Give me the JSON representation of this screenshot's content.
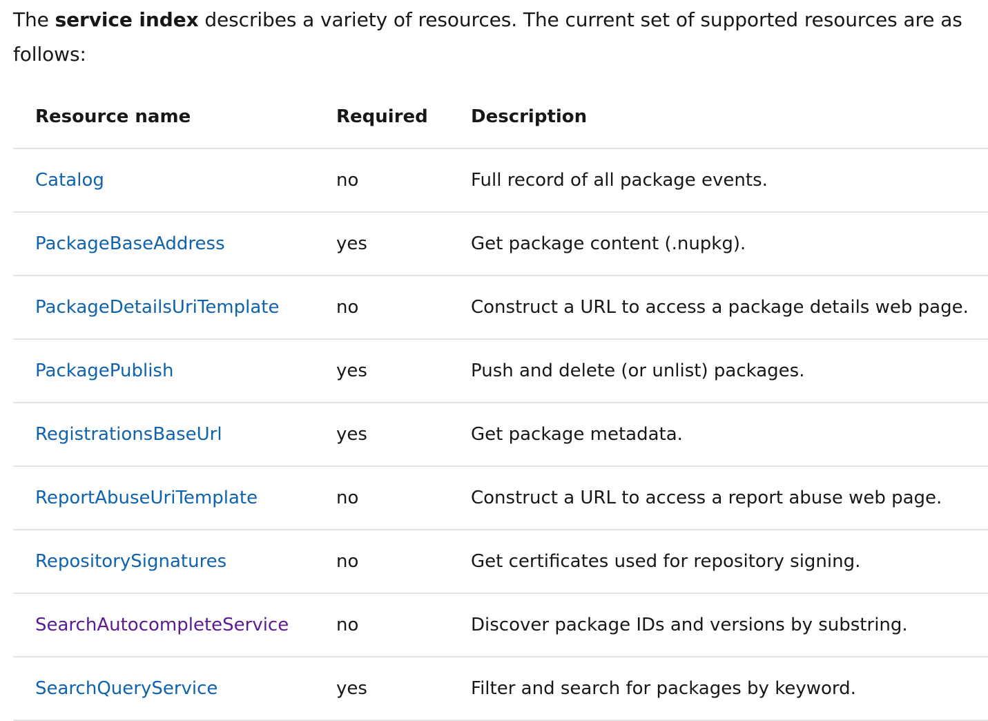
{
  "intro": {
    "prefix": "The ",
    "bold": "service index",
    "suffix": " describes a variety of resources. The current set of supported resources are as follows:"
  },
  "table": {
    "headers": {
      "name": "Resource name",
      "required": "Required",
      "description": "Description"
    },
    "rows": [
      {
        "name": "Catalog",
        "required": "no",
        "description": "Full record of all package events.",
        "visited": false
      },
      {
        "name": "PackageBaseAddress",
        "required": "yes",
        "description": "Get package content (.nupkg).",
        "visited": false
      },
      {
        "name": "PackageDetailsUriTemplate",
        "required": "no",
        "description": "Construct a URL to access a package details web page.",
        "visited": false
      },
      {
        "name": "PackagePublish",
        "required": "yes",
        "description": "Push and delete (or unlist) packages.",
        "visited": false
      },
      {
        "name": "RegistrationsBaseUrl",
        "required": "yes",
        "description": "Get package metadata.",
        "visited": false
      },
      {
        "name": "ReportAbuseUriTemplate",
        "required": "no",
        "description": "Construct a URL to access a report abuse web page.",
        "visited": false
      },
      {
        "name": "RepositorySignatures",
        "required": "no",
        "description": "Get certificates used for repository signing.",
        "visited": false
      },
      {
        "name": "SearchAutocompleteService",
        "required": "no",
        "description": "Discover package IDs and versions by substring.",
        "visited": true
      },
      {
        "name": "SearchQueryService",
        "required": "yes",
        "description": "Filter and search for packages by keyword.",
        "visited": false
      }
    ]
  },
  "colors": {
    "link": "#0f62ad",
    "visited_link": "#5c1a92",
    "text": "#171717",
    "divider": "#e3e3e3"
  }
}
